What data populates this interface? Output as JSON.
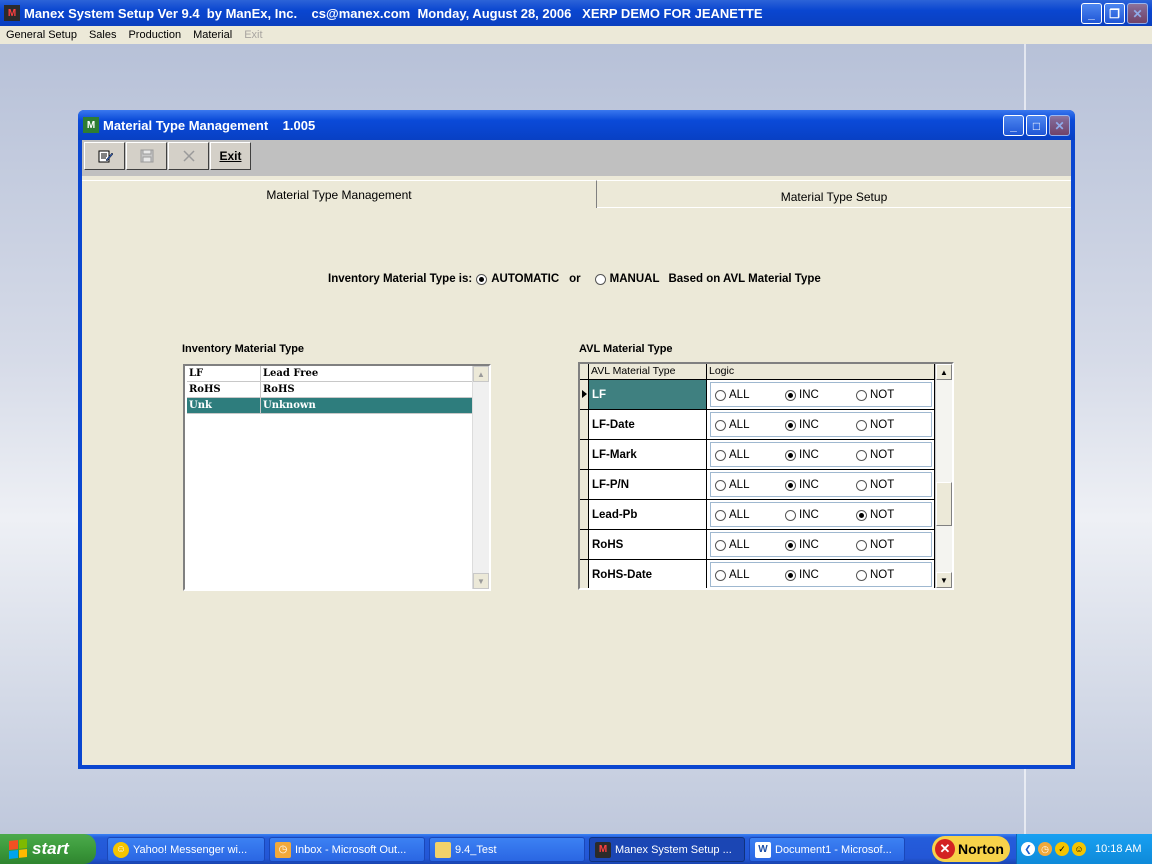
{
  "app": {
    "title": "Manex System Setup Ver 9.4  by ManEx, Inc.    cs@manex.com  Monday, August 28, 2006   XERP DEMO FOR JEANETTE",
    "logo": "M"
  },
  "menu": {
    "items": [
      {
        "label": "General Setup",
        "enabled": true
      },
      {
        "label": "Sales",
        "enabled": true
      },
      {
        "label": "Production",
        "enabled": true
      },
      {
        "label": "Material",
        "enabled": true
      },
      {
        "label": "Exit",
        "enabled": false
      }
    ]
  },
  "window": {
    "title": "Material Type Management    1.005",
    "toolbar": {
      "edit_icon": "edit-icon",
      "save_icon": "save-icon",
      "cancel_icon": "cancel-icon",
      "exit_label": "Exit"
    },
    "tabs": [
      {
        "label": "Material Type Management",
        "active": true
      },
      {
        "label": "Material Type Setup",
        "active": false
      }
    ],
    "inv_type": {
      "prefix": "Inventory Material Type is:",
      "automatic": "AUTOMATIC",
      "or": "or",
      "manual": "MANUAL",
      "suffix": "Based on AVL Material Type",
      "selected": "AUTOMATIC"
    },
    "inventory": {
      "label": "Inventory Material Type",
      "rows": [
        {
          "code": "LF",
          "description": "Lead Free",
          "selected": false
        },
        {
          "code": "RoHS",
          "description": "RoHS",
          "selected": false
        },
        {
          "code": "Unk",
          "description": "Unknown",
          "selected": true
        }
      ]
    },
    "avl": {
      "label": "AVL Material Type",
      "columns": [
        "AVL Material Type",
        "Logic"
      ],
      "options": [
        "ALL",
        "INC",
        "NOT"
      ],
      "rows": [
        {
          "type": "LF",
          "logic": "INC",
          "current": true
        },
        {
          "type": "LF-Date",
          "logic": "INC",
          "current": false
        },
        {
          "type": "LF-Mark",
          "logic": "INC",
          "current": false
        },
        {
          "type": "LF-P/N",
          "logic": "INC",
          "current": false
        },
        {
          "type": "Lead-Pb",
          "logic": "NOT",
          "current": false
        },
        {
          "type": "RoHS",
          "logic": "INC",
          "current": false
        },
        {
          "type": "RoHS-Date",
          "logic": "INC",
          "current": false
        }
      ]
    }
  },
  "taskbar": {
    "start_label": "start",
    "tasks": [
      {
        "label": "Yahoo! Messenger wi...",
        "icon": "yahoo-messenger-icon",
        "active": false
      },
      {
        "label": "Inbox - Microsoft Out...",
        "icon": "outlook-icon",
        "active": false
      },
      {
        "label": "9.4_Test",
        "icon": "folder-icon",
        "active": false
      },
      {
        "label": "Manex System Setup ...",
        "icon": "manex-icon",
        "active": true
      },
      {
        "label": "Document1 - Microsof...",
        "icon": "word-icon",
        "active": false
      }
    ],
    "norton_label": "Norton",
    "clock": "10:18 AM"
  }
}
